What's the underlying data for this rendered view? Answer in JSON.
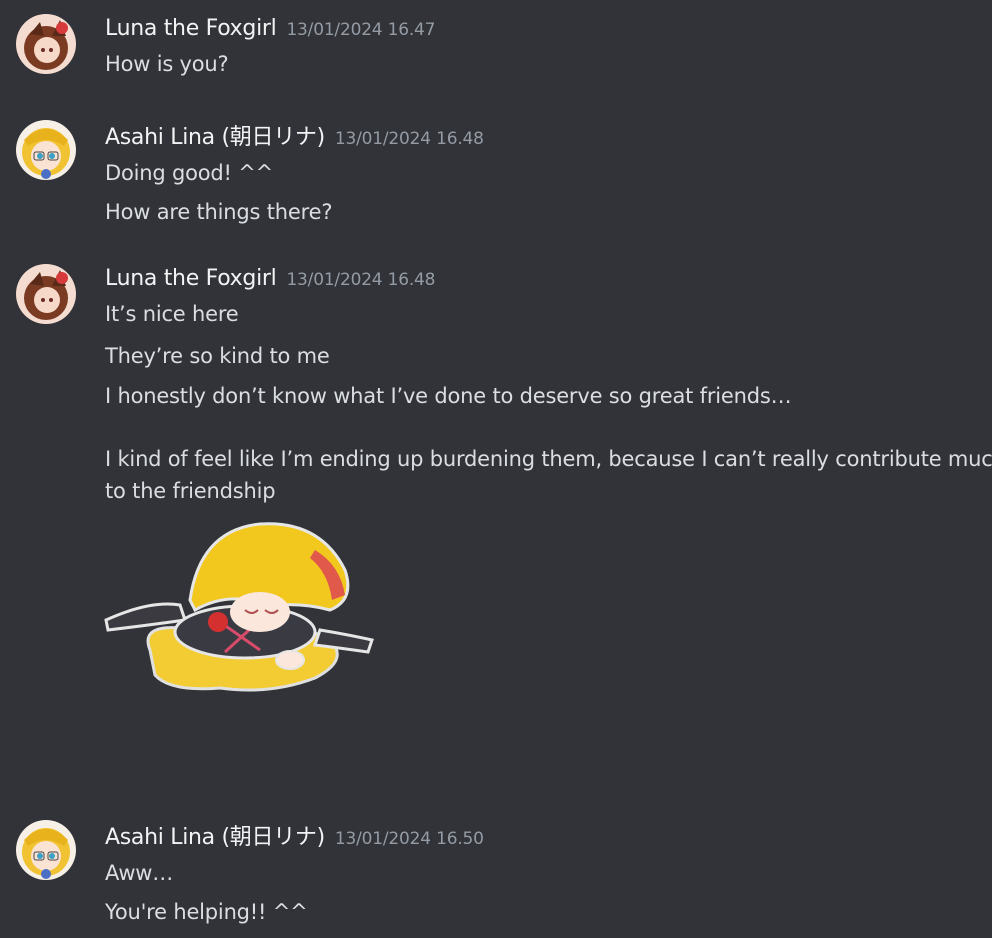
{
  "messages": [
    {
      "author": "Luna the Foxgirl",
      "timestamp": "13/01/2024 16.47",
      "avatar_icon": "foxgirl-avatar-icon",
      "lines": [
        "How is you?"
      ]
    },
    {
      "author": "Asahi Lina (朝日リナ)",
      "timestamp": "13/01/2024 16.48",
      "avatar_icon": "asahi-lina-avatar-icon",
      "lines": [
        "Doing good! ^^",
        "How are things there?"
      ]
    },
    {
      "author": "Luna the Foxgirl",
      "timestamp": "13/01/2024 16.48",
      "avatar_icon": "foxgirl-avatar-icon",
      "lines": [
        "It’s nice here",
        "They’re so kind to me",
        "I honestly don’t know what I’ve done to deserve so great friends…",
        "I kind of feel like I’m ending up burdening them, because I can’t really contribute much",
        "to the friendship"
      ],
      "sticker": "melting-girl-sticker-icon"
    },
    {
      "author": "Asahi Lina (朝日リナ)",
      "timestamp": "13/01/2024 16.50",
      "avatar_icon": "asahi-lina-avatar-icon",
      "lines": [
        "Aww…",
        "You're helping!! ^^"
      ]
    }
  ],
  "colors": {
    "background": "#313338",
    "author": "#f2f3f5",
    "timestamp": "#949ba4",
    "text": "#dbdee1"
  }
}
